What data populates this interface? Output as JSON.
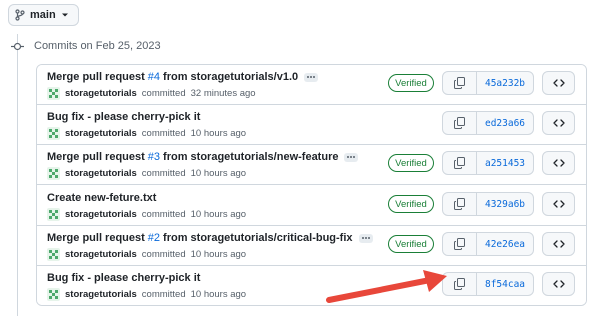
{
  "branch": {
    "name": "main",
    "icon": "git-branch-icon"
  },
  "timeline": {
    "date_heading": "Commits on Feb 25, 2023"
  },
  "commits": [
    {
      "prefix": "Merge pull request ",
      "pr": "#4",
      "suffix": " from storagetutorials/v1.0",
      "has_ellipsis": true,
      "author": "storagetutorials",
      "action": "committed",
      "time": "32 minutes ago",
      "verified": "Verified",
      "sha": "45a232b"
    },
    {
      "prefix": "Bug fix - please cherry-pick it",
      "pr": "",
      "suffix": "",
      "has_ellipsis": false,
      "author": "storagetutorials",
      "action": "committed",
      "time": "10 hours ago",
      "verified": "",
      "sha": "ed23a66"
    },
    {
      "prefix": "Merge pull request ",
      "pr": "#3",
      "suffix": " from storagetutorials/new-feature",
      "has_ellipsis": true,
      "author": "storagetutorials",
      "action": "committed",
      "time": "10 hours ago",
      "verified": "Verified",
      "sha": "a251453"
    },
    {
      "prefix": "Create new-feture.txt",
      "pr": "",
      "suffix": "",
      "has_ellipsis": false,
      "author": "storagetutorials",
      "action": "committed",
      "time": "10 hours ago",
      "verified": "Verified",
      "sha": "4329a6b"
    },
    {
      "prefix": "Merge pull request ",
      "pr": "#2",
      "suffix": " from storagetutorials/critical-bug-fix",
      "has_ellipsis": true,
      "author": "storagetutorials",
      "action": "committed",
      "time": "10 hours ago",
      "verified": "Verified",
      "sha": "42e26ea"
    },
    {
      "prefix": "Bug fix - please cherry-pick it",
      "pr": "",
      "suffix": "",
      "has_ellipsis": false,
      "author": "storagetutorials",
      "action": "committed",
      "time": "10 hours ago",
      "verified": "",
      "sha": "8f54caa"
    }
  ],
  "colors": {
    "accent": "#0969da",
    "verified": "#1a7f37",
    "annotation_arrow": "#e8473a",
    "avatar": "#4ca86b"
  }
}
